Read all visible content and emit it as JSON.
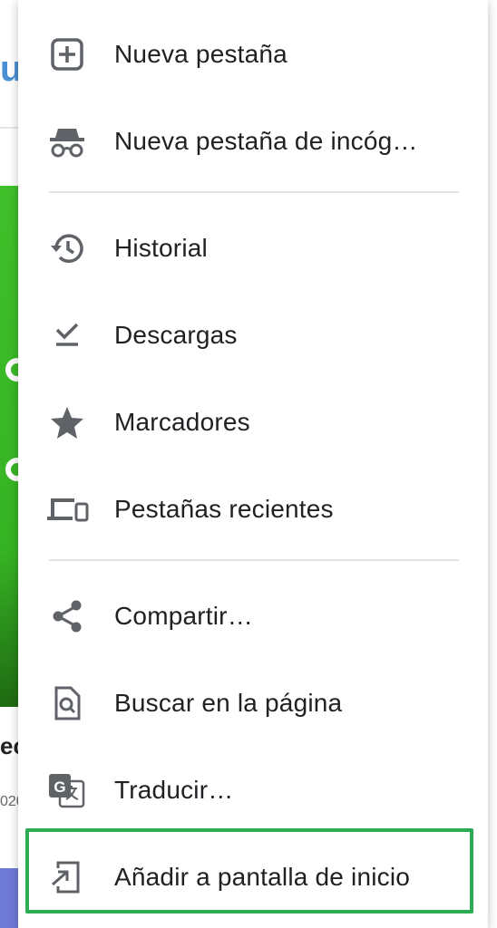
{
  "menu": {
    "items": [
      {
        "label": "Nueva pestaña",
        "icon": "plus-box-icon"
      },
      {
        "label": "Nueva pestaña de incóg…",
        "icon": "incognito-icon"
      },
      {
        "label": "Historial",
        "icon": "history-icon"
      },
      {
        "label": "Descargas",
        "icon": "download-icon"
      },
      {
        "label": "Marcadores",
        "icon": "star-icon"
      },
      {
        "label": "Pestañas recientes",
        "icon": "devices-icon"
      },
      {
        "label": "Compartir…",
        "icon": "share-icon"
      },
      {
        "label": "Buscar en la página",
        "icon": "find-in-page-icon"
      },
      {
        "label": "Traducir…",
        "icon": "translate-icon"
      },
      {
        "label": "Añadir a pantalla de inicio",
        "icon": "add-to-home-icon"
      }
    ],
    "highlighted_item": "Añadir a pantalla de inicio"
  },
  "background": {
    "logo_fragment": "u",
    "text_fragment": "ec",
    "date_fragment": "020"
  },
  "colors": {
    "icon": "#5f6368",
    "text": "#202124",
    "highlight_border": "#2eab55",
    "hero_green": "#3fbf2a"
  }
}
